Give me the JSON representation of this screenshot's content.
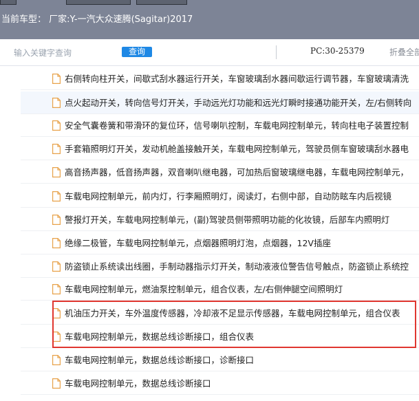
{
  "header": {
    "vehicle_label": "当前车型：  厂家:Y-一汽大众速腾(Sagitar)2017"
  },
  "toolbar": {
    "search_placeholder": "输入关键字查询",
    "search_button": "查询",
    "pc_code": "PC:30-25379",
    "collapse_all": "折叠全部"
  },
  "items": [
    {
      "text": "右侧转向柱开关，间歇式刮水器运行开关，车窗玻璃刮水器间歇运行调节器，车窗玻璃清洗"
    },
    {
      "text": "点火起动开关，转向信号灯开关，手动远光灯功能和远光灯瞬时接通功能开关，左/右侧转向"
    },
    {
      "text": "安全气囊卷簧和带滑环的复位环，信号喇叭控制，车载电网控制单元，转向柱电子装置控制"
    },
    {
      "text": "手套箱照明灯开关，发动机舱盖接触开关，车载电网控制单元，驾驶员侧车窗玻璃刮水器电"
    },
    {
      "text": "高音扬声器，低音扬声器，双音喇叭继电器，可加热后窗玻璃继电器，车载电网控制单元，"
    },
    {
      "text": "车载电网控制单元，前内灯，行李厢照明灯，阅读灯，右侧中部，自动防眩车内后视镜"
    },
    {
      "text": "警报灯开关，车载电网控制单元，(副)驾驶员侧带照明功能的化妆镜，后部车内照明灯"
    },
    {
      "text": "绝缘二极管，车载电网控制单元，点烟器照明灯泡，点烟器，12V插座"
    },
    {
      "text": "防盗锁止系统读出线圈，手制动器指示灯开关，制动液液位警告信号触点，防盗锁止系统控"
    },
    {
      "text": "车载电网控制单元，燃油泵控制单元，组合仪表，左/右侧伸腿空间照明灯"
    },
    {
      "text": "机油压力开关，车外温度传感器，冷却液不足显示传感器，车载电网控制单元，组合仪表"
    },
    {
      "text": "车载电网控制单元，数据总线诊断接口，组合仪表"
    },
    {
      "text": "车载电网控制单元，数据总线诊断接口，诊断接口"
    },
    {
      "text": "车载电网控制单元，数据总线诊断接口"
    }
  ],
  "colors": {
    "header_bg": "#7d8496",
    "accent_button": "#1e88e5",
    "highlight_box": "#e0362f",
    "doc_icon": "#e8a24a"
  }
}
